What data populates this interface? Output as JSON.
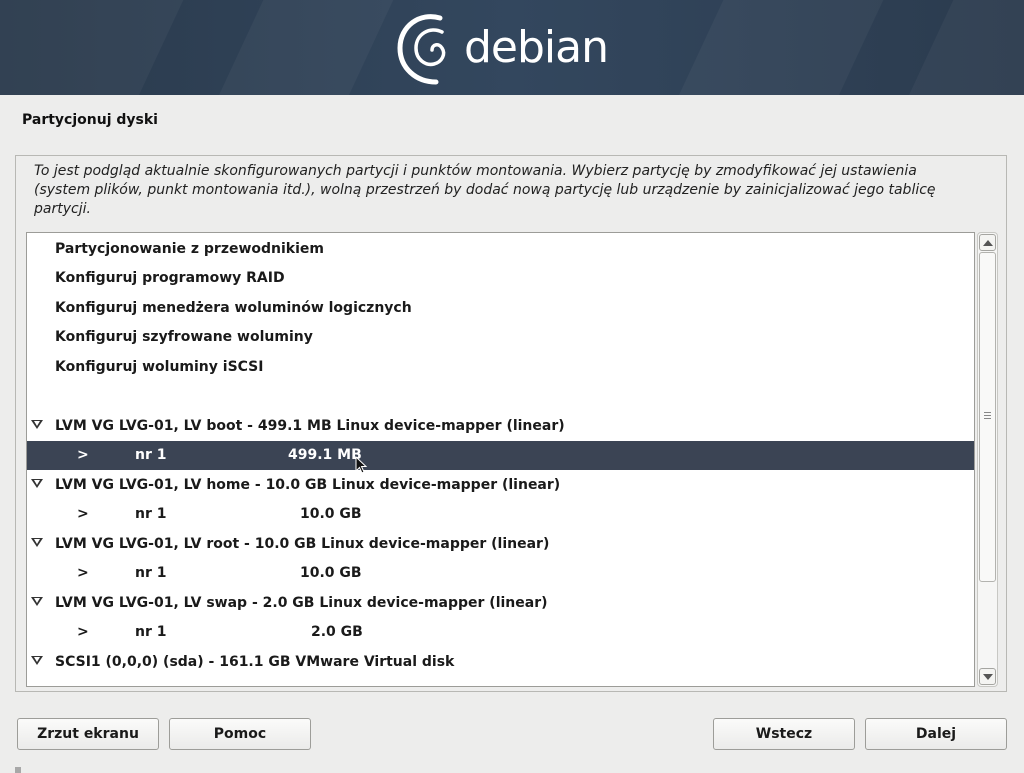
{
  "banner": {
    "logo_text": "debian"
  },
  "page": {
    "title": "Partycjonuj dyski",
    "description": "To jest podgląd aktualnie skonfigurowanych partycji i punktów montowania. Wybierz partycję by zmodyfikować jej ustawienia (system plików, punkt montowania itd.), wolną przestrzeń by dodać nową partycję lub urządzenie by zainicjalizować jego tablicę partycji."
  },
  "menu": {
    "items": [
      "Partycjonowanie z przewodnikiem",
      "Konfiguruj programowy RAID",
      "Konfiguruj menedżera woluminów logicznych",
      "Konfiguruj szyfrowane woluminy",
      "Konfiguruj woluminy iSCSI"
    ]
  },
  "devices": [
    {
      "header": "LVM VG LVG-01, LV boot - 499.1 MB Linux device-mapper (linear)",
      "part": {
        "marker": ">",
        "num": "nr 1",
        "size": "499.1 MB"
      }
    },
    {
      "header": "LVM VG LVG-01, LV home - 10.0 GB Linux device-mapper (linear)",
      "part": {
        "marker": ">",
        "num": "nr 1",
        "size": "10.0 GB"
      }
    },
    {
      "header": "LVM VG LVG-01, LV root - 10.0 GB Linux device-mapper (linear)",
      "part": {
        "marker": ">",
        "num": "nr 1",
        "size": "10.0 GB"
      }
    },
    {
      "header": "LVM VG LVG-01, LV swap - 2.0 GB Linux device-mapper (linear)",
      "part": {
        "marker": ">",
        "num": "nr 1",
        "size": "2.0 GB"
      }
    },
    {
      "header": "SCSI1 (0,0,0) (sda) - 161.1 GB VMware Virtual disk"
    }
  ],
  "buttons": {
    "screenshot": "Zrzut ekranu",
    "help": "Pomoc",
    "back": "Wstecz",
    "next": "Dalej"
  },
  "colors": {
    "selection": "#3b4454",
    "banner": "#33475e"
  }
}
